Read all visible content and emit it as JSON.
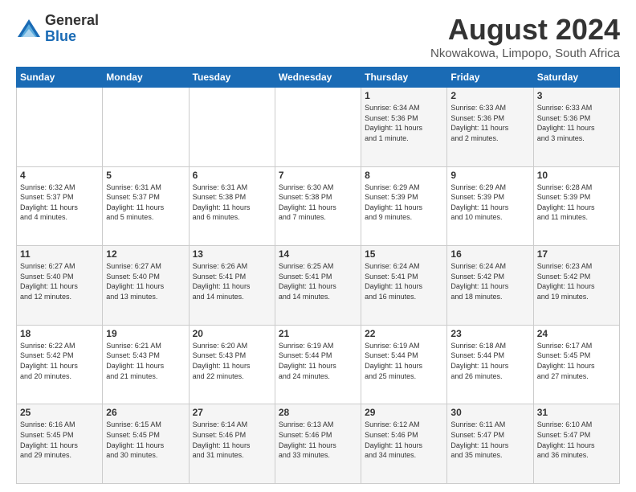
{
  "logo": {
    "general": "General",
    "blue": "Blue"
  },
  "title": "August 2024",
  "subtitle": "Nkowakowa, Limpopo, South Africa",
  "days_of_week": [
    "Sunday",
    "Monday",
    "Tuesday",
    "Wednesday",
    "Thursday",
    "Friday",
    "Saturday"
  ],
  "weeks": [
    [
      {
        "day": "",
        "info": ""
      },
      {
        "day": "",
        "info": ""
      },
      {
        "day": "",
        "info": ""
      },
      {
        "day": "",
        "info": ""
      },
      {
        "day": "1",
        "info": "Sunrise: 6:34 AM\nSunset: 5:36 PM\nDaylight: 11 hours\nand 1 minute."
      },
      {
        "day": "2",
        "info": "Sunrise: 6:33 AM\nSunset: 5:36 PM\nDaylight: 11 hours\nand 2 minutes."
      },
      {
        "day": "3",
        "info": "Sunrise: 6:33 AM\nSunset: 5:36 PM\nDaylight: 11 hours\nand 3 minutes."
      }
    ],
    [
      {
        "day": "4",
        "info": "Sunrise: 6:32 AM\nSunset: 5:37 PM\nDaylight: 11 hours\nand 4 minutes."
      },
      {
        "day": "5",
        "info": "Sunrise: 6:31 AM\nSunset: 5:37 PM\nDaylight: 11 hours\nand 5 minutes."
      },
      {
        "day": "6",
        "info": "Sunrise: 6:31 AM\nSunset: 5:38 PM\nDaylight: 11 hours\nand 6 minutes."
      },
      {
        "day": "7",
        "info": "Sunrise: 6:30 AM\nSunset: 5:38 PM\nDaylight: 11 hours\nand 7 minutes."
      },
      {
        "day": "8",
        "info": "Sunrise: 6:29 AM\nSunset: 5:39 PM\nDaylight: 11 hours\nand 9 minutes."
      },
      {
        "day": "9",
        "info": "Sunrise: 6:29 AM\nSunset: 5:39 PM\nDaylight: 11 hours\nand 10 minutes."
      },
      {
        "day": "10",
        "info": "Sunrise: 6:28 AM\nSunset: 5:39 PM\nDaylight: 11 hours\nand 11 minutes."
      }
    ],
    [
      {
        "day": "11",
        "info": "Sunrise: 6:27 AM\nSunset: 5:40 PM\nDaylight: 11 hours\nand 12 minutes."
      },
      {
        "day": "12",
        "info": "Sunrise: 6:27 AM\nSunset: 5:40 PM\nDaylight: 11 hours\nand 13 minutes."
      },
      {
        "day": "13",
        "info": "Sunrise: 6:26 AM\nSunset: 5:41 PM\nDaylight: 11 hours\nand 14 minutes."
      },
      {
        "day": "14",
        "info": "Sunrise: 6:25 AM\nSunset: 5:41 PM\nDaylight: 11 hours\nand 14 minutes."
      },
      {
        "day": "15",
        "info": "Sunrise: 6:24 AM\nSunset: 5:41 PM\nDaylight: 11 hours\nand 16 minutes."
      },
      {
        "day": "16",
        "info": "Sunrise: 6:24 AM\nSunset: 5:42 PM\nDaylight: 11 hours\nand 18 minutes."
      },
      {
        "day": "17",
        "info": "Sunrise: 6:23 AM\nSunset: 5:42 PM\nDaylight: 11 hours\nand 19 minutes."
      }
    ],
    [
      {
        "day": "18",
        "info": "Sunrise: 6:22 AM\nSunset: 5:42 PM\nDaylight: 11 hours\nand 20 minutes."
      },
      {
        "day": "19",
        "info": "Sunrise: 6:21 AM\nSunset: 5:43 PM\nDaylight: 11 hours\nand 21 minutes."
      },
      {
        "day": "20",
        "info": "Sunrise: 6:20 AM\nSunset: 5:43 PM\nDaylight: 11 hours\nand 22 minutes."
      },
      {
        "day": "21",
        "info": "Sunrise: 6:19 AM\nSunset: 5:44 PM\nDaylight: 11 hours\nand 24 minutes."
      },
      {
        "day": "22",
        "info": "Sunrise: 6:19 AM\nSunset: 5:44 PM\nDaylight: 11 hours\nand 25 minutes."
      },
      {
        "day": "23",
        "info": "Sunrise: 6:18 AM\nSunset: 5:44 PM\nDaylight: 11 hours\nand 26 minutes."
      },
      {
        "day": "24",
        "info": "Sunrise: 6:17 AM\nSunset: 5:45 PM\nDaylight: 11 hours\nand 27 minutes."
      }
    ],
    [
      {
        "day": "25",
        "info": "Sunrise: 6:16 AM\nSunset: 5:45 PM\nDaylight: 11 hours\nand 29 minutes."
      },
      {
        "day": "26",
        "info": "Sunrise: 6:15 AM\nSunset: 5:45 PM\nDaylight: 11 hours\nand 30 minutes."
      },
      {
        "day": "27",
        "info": "Sunrise: 6:14 AM\nSunset: 5:46 PM\nDaylight: 11 hours\nand 31 minutes."
      },
      {
        "day": "28",
        "info": "Sunrise: 6:13 AM\nSunset: 5:46 PM\nDaylight: 11 hours\nand 33 minutes."
      },
      {
        "day": "29",
        "info": "Sunrise: 6:12 AM\nSunset: 5:46 PM\nDaylight: 11 hours\nand 34 minutes."
      },
      {
        "day": "30",
        "info": "Sunrise: 6:11 AM\nSunset: 5:47 PM\nDaylight: 11 hours\nand 35 minutes."
      },
      {
        "day": "31",
        "info": "Sunrise: 6:10 AM\nSunset: 5:47 PM\nDaylight: 11 hours\nand 36 minutes."
      }
    ]
  ]
}
